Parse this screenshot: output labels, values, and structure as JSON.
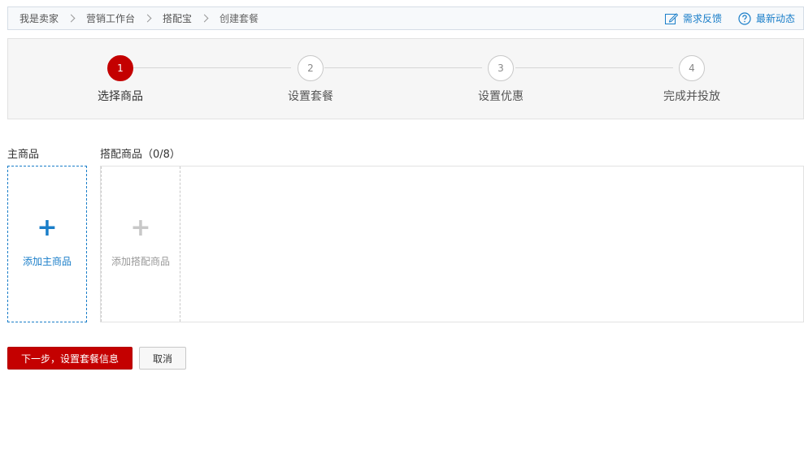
{
  "breadcrumb": {
    "items": [
      "我是卖家",
      "营销工作台",
      "搭配宝",
      "创建套餐"
    ]
  },
  "header_links": {
    "feedback": "需求反馈",
    "news": "最新动态"
  },
  "steps": [
    {
      "number": "1",
      "label": "选择商品"
    },
    {
      "number": "2",
      "label": "设置套餐"
    },
    {
      "number": "3",
      "label": "设置优惠"
    },
    {
      "number": "4",
      "label": "完成并投放"
    }
  ],
  "main_product": {
    "title": "主商品",
    "add_label": "添加主商品",
    "plus": "+"
  },
  "combo_products": {
    "title": "搭配商品（0/8）",
    "add_label": "添加搭配商品",
    "plus": "+"
  },
  "actions": {
    "next": "下一步，设置套餐信息",
    "cancel": "取消"
  },
  "colors": {
    "accent": "#c40000",
    "link": "#1a7ec9"
  }
}
